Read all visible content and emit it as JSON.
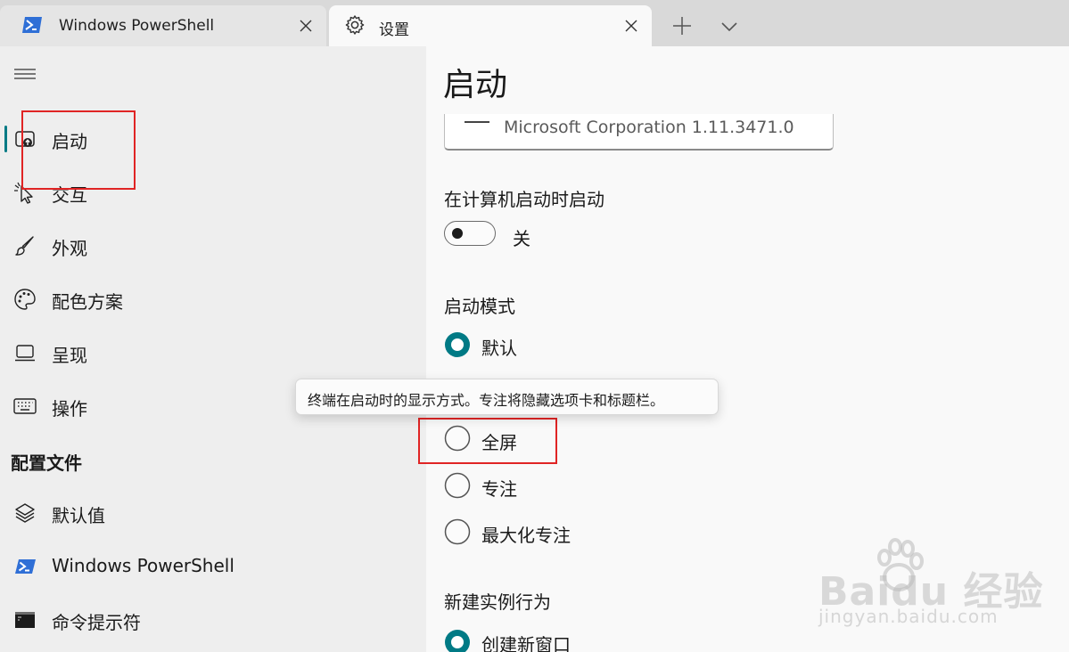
{
  "tabs": [
    {
      "title": "Windows PowerShell",
      "icon": "powershell-icon"
    },
    {
      "title": "设置",
      "icon": "gear-icon"
    }
  ],
  "sidebar": {
    "items": [
      {
        "label": "启动",
        "icon": "startup-icon"
      },
      {
        "label": "交互",
        "icon": "cursor-icon"
      },
      {
        "label": "外观",
        "icon": "brush-icon"
      },
      {
        "label": "配色方案",
        "icon": "palette-icon"
      },
      {
        "label": "呈现",
        "icon": "monitor-icon"
      },
      {
        "label": "操作",
        "icon": "keyboard-icon"
      }
    ],
    "section_title": "配置文件",
    "profiles": [
      {
        "label": "默认值",
        "icon": "layers-icon"
      },
      {
        "label": "Windows PowerShell",
        "icon": "powershell-icon"
      },
      {
        "label": "命令提示符",
        "icon": "cmd-icon"
      }
    ]
  },
  "main": {
    "title": "启动",
    "terminal_combo_text": "Microsoft Corporation  1.11.3471.0",
    "launch_on_startup_label": "在计算机启动时启动",
    "toggle_state": "关",
    "launch_mode_label": "启动模式",
    "launch_mode_options": [
      {
        "label": "默认",
        "selected": true
      },
      {
        "label": "全屏",
        "selected": false
      },
      {
        "label": "专注",
        "selected": false
      },
      {
        "label": "最大化专注",
        "selected": false
      }
    ],
    "new_instance_label": "新建实例行为",
    "new_instance_option": "创建新窗口",
    "tooltip": "终端在启动时的显示方式。专注将隐藏选项卡和标题栏。"
  },
  "watermark": {
    "logo": "Baidu 经验",
    "url": "jingyan.baidu.com"
  },
  "colors": {
    "accent": "#007a85",
    "highlight_box": "#e02424",
    "powershell_blue": "#2f6fd6"
  }
}
